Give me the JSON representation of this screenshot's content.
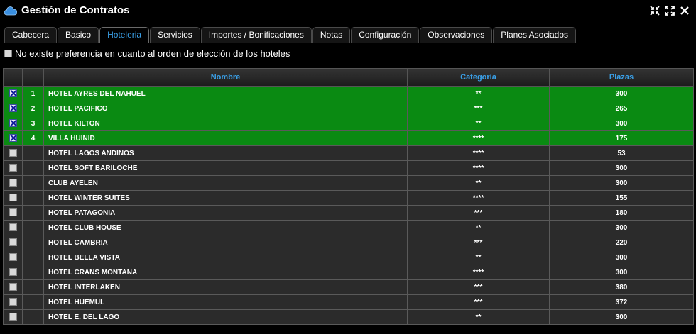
{
  "window": {
    "title": "Gestión de Contratos",
    "buttons": [
      "minimize-icon",
      "maximize-icon",
      "close-icon"
    ]
  },
  "tabs": [
    {
      "label": "Cabecera",
      "active": false
    },
    {
      "label": "Basico",
      "active": false
    },
    {
      "label": "Hoteleria",
      "active": true
    },
    {
      "label": "Servicios",
      "active": false
    },
    {
      "label": "Importes / Bonificaciones",
      "active": false
    },
    {
      "label": "Notas",
      "active": false
    },
    {
      "label": "Configuración",
      "active": false
    },
    {
      "label": "Observaciones",
      "active": false
    },
    {
      "label": "Planes Asociados",
      "active": false
    }
  ],
  "preference": {
    "label": "No existe preferencia en cuanto al orden de elección de los hoteles",
    "checked": false
  },
  "colors": {
    "selected_row": "#0a8a12",
    "header_text": "#3aa0e8",
    "row_bg": "#2b2b2b"
  },
  "table": {
    "columns": [
      "",
      "",
      "Nombre",
      "Categoría",
      "Plazas"
    ],
    "rows": [
      {
        "checked": true,
        "order": "1",
        "name": "HOTEL AYRES DEL NAHUEL",
        "category": "**",
        "plazas": "300"
      },
      {
        "checked": true,
        "order": "2",
        "name": "HOTEL PACIFICO",
        "category": "***",
        "plazas": "265"
      },
      {
        "checked": true,
        "order": "3",
        "name": "HOTEL KILTON",
        "category": "**",
        "plazas": "300"
      },
      {
        "checked": true,
        "order": "4",
        "name": "VILLA HUINID",
        "category": "****",
        "plazas": "175"
      },
      {
        "checked": false,
        "order": "",
        "name": "HOTEL LAGOS ANDINOS",
        "category": "****",
        "plazas": "53"
      },
      {
        "checked": false,
        "order": "",
        "name": "HOTEL SOFT BARILOCHE",
        "category": "****",
        "plazas": "300"
      },
      {
        "checked": false,
        "order": "",
        "name": "CLUB AYELEN",
        "category": "**",
        "plazas": "300"
      },
      {
        "checked": false,
        "order": "",
        "name": "HOTEL WINTER SUITES",
        "category": "****",
        "plazas": "155"
      },
      {
        "checked": false,
        "order": "",
        "name": "HOTEL PATAGONIA",
        "category": "***",
        "plazas": "180"
      },
      {
        "checked": false,
        "order": "",
        "name": "HOTEL CLUB HOUSE",
        "category": "**",
        "plazas": "300"
      },
      {
        "checked": false,
        "order": "",
        "name": "HOTEL CAMBRIA",
        "category": "***",
        "plazas": "220"
      },
      {
        "checked": false,
        "order": "",
        "name": "HOTEL BELLA VISTA",
        "category": "**",
        "plazas": "300"
      },
      {
        "checked": false,
        "order": "",
        "name": "HOTEL CRANS MONTANA",
        "category": "****",
        "plazas": "300"
      },
      {
        "checked": false,
        "order": "",
        "name": "HOTEL INTERLAKEN",
        "category": "***",
        "plazas": "380"
      },
      {
        "checked": false,
        "order": "",
        "name": "HOTEL HUEMUL",
        "category": "***",
        "plazas": "372"
      },
      {
        "checked": false,
        "order": "",
        "name": "HOTEL E. DEL LAGO",
        "category": "**",
        "plazas": "300"
      }
    ]
  }
}
